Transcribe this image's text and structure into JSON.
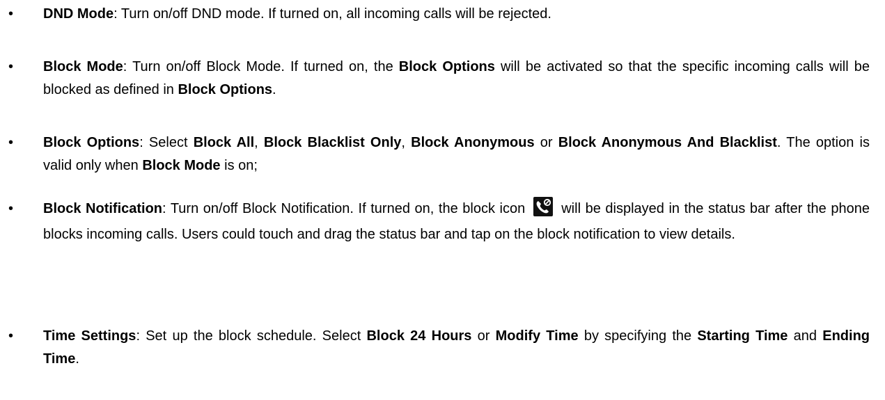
{
  "bullet_glyph": "•",
  "items": [
    {
      "term": "DND Mode",
      "sep": ": ",
      "text": "Turn on/off DND mode. If turned on, all incoming calls will be rejected."
    },
    {
      "term": "Block Mode",
      "sep": ": ",
      "t1": "Turn on/off Block Mode. If turned on, the ",
      "b1": "Block Options",
      "t2": " will be activated so that the specific incoming calls will be blocked as defined in ",
      "b2": "Block Options",
      "t3": "."
    },
    {
      "term": "Block Options",
      "sep": ": ",
      "t1": "Select ",
      "b1": "Block All",
      "t2": ", ",
      "b2": "Block Blacklist Only",
      "t3": ", ",
      "b3": "Block Anonymous",
      "t4": " or ",
      "b4": "Block Anonymous And Blacklist",
      "t5": ". The option is valid only when ",
      "b5": "Block Mode",
      "t6": " is on;"
    },
    {
      "term": "Block Notification",
      "sep": ": ",
      "t1": "Turn on/off Block Notification. If turned on, the block icon",
      "icon": "phone-block-icon",
      "t2": "will be displayed in the status bar after the phone blocks incoming calls. Users could touch and drag the status bar and tap on the block notification to view details."
    },
    {
      "term": "Time Settings",
      "sep": ": ",
      "t1": "Set up the block schedule. Select ",
      "b1": "Block 24 Hours",
      "t2": " or ",
      "b2": "Modify Time",
      "t3": " by specifying the ",
      "b3": "Starting Time",
      "t4": " and ",
      "b4": "Ending Time",
      "t5": "."
    }
  ]
}
